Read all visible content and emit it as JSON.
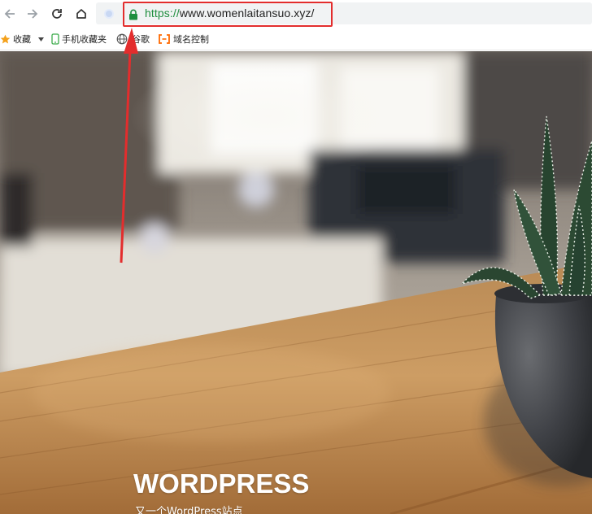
{
  "browser": {
    "nav_icons": [
      "back-arrow-icon",
      "forward-arrow-icon",
      "reload-icon",
      "home-icon"
    ],
    "address_bar": {
      "scheme": "https://",
      "host_path": "www.womenlaitansuo.xyz/",
      "secure": true
    },
    "accent_colors": {
      "secure_green": "#1e8e3e",
      "highlight_red": "#e32d2d"
    }
  },
  "bookmarks_bar": {
    "favorites_label": "收藏",
    "items": [
      {
        "label": "手机收藏夹",
        "icon": "phone-icon"
      },
      {
        "label": "谷歌",
        "icon": "globe-icon"
      },
      {
        "label": "域名控制",
        "icon": "bracket-icon"
      }
    ]
  },
  "site": {
    "title": "WORDPRESS",
    "tagline": "又一个WordPress站点"
  }
}
